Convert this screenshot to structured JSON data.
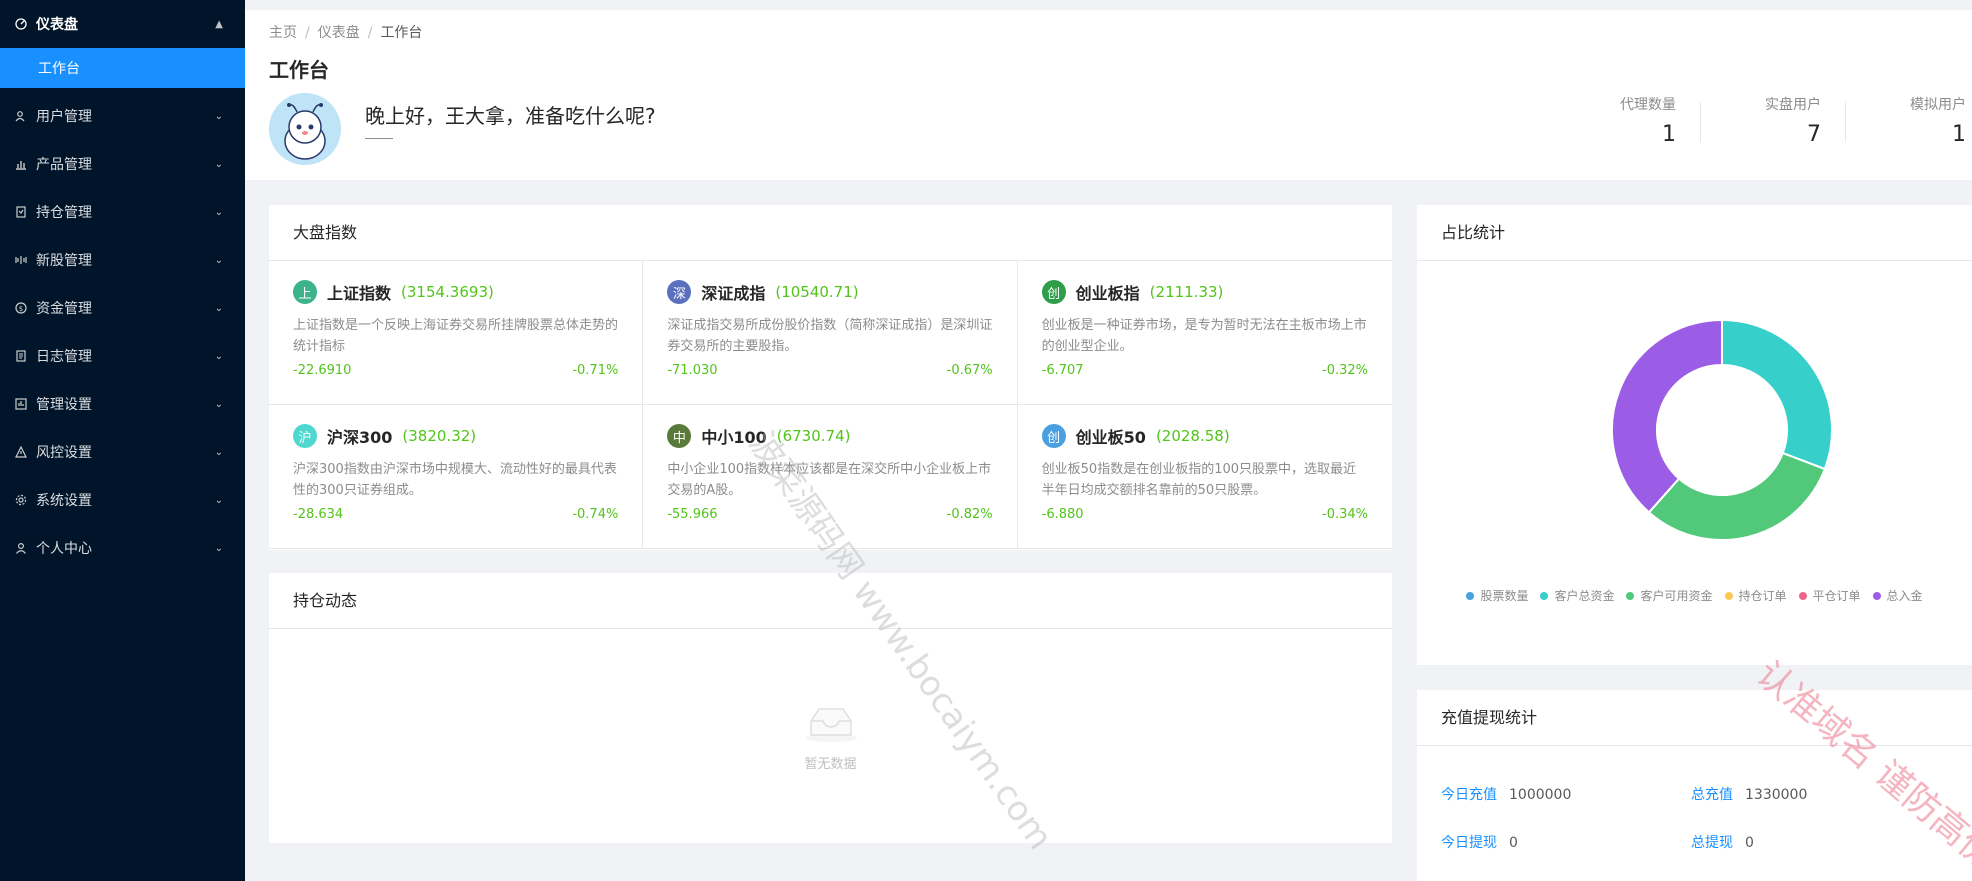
{
  "sidebar": {
    "items": [
      {
        "label": "仪表盘",
        "icon": "dashboard-icon",
        "open": true,
        "children": [
          {
            "label": "工作台"
          }
        ]
      },
      {
        "label": "用户管理",
        "icon": "users-icon"
      },
      {
        "label": "产品管理",
        "icon": "chart-icon"
      },
      {
        "label": "持仓管理",
        "icon": "position-icon"
      },
      {
        "label": "新股管理",
        "icon": "ipo-icon"
      },
      {
        "label": "资金管理",
        "icon": "money-icon"
      },
      {
        "label": "日志管理",
        "icon": "log-icon"
      },
      {
        "label": "管理设置",
        "icon": "admin-icon"
      },
      {
        "label": "风控设置",
        "icon": "warning-icon"
      },
      {
        "label": "系统设置",
        "icon": "gear-icon"
      },
      {
        "label": "个人中心",
        "icon": "user-icon"
      }
    ]
  },
  "breadcrumb": [
    "主页",
    "仪表盘",
    "工作台"
  ],
  "page_title": "工作台",
  "greeting": "晚上好，王大拿，准备吃什么呢?",
  "stats": [
    {
      "label": "代理数量",
      "value": "1"
    },
    {
      "label": "实盘用户",
      "value": "7"
    },
    {
      "label": "模拟用户",
      "value": "1"
    }
  ],
  "market": {
    "title": "大盘指数",
    "indices": [
      {
        "badge": "上",
        "badge_color": "#3db389",
        "name": "上证指数",
        "value": "(3154.3693)",
        "desc": "上证指数是一个反映上海证券交易所挂牌股票总体走势的统计指标",
        "change": "-22.6910",
        "pct": "-0.71%"
      },
      {
        "badge": "深",
        "badge_color": "#5b6fbf",
        "name": "深证成指",
        "value": "(10540.71)",
        "desc": "深证成指交易所成份股价指数（简称深证成指）是深圳证券交易所的主要股指。",
        "change": "-71.030",
        "pct": "-0.67%"
      },
      {
        "badge": "创",
        "badge_color": "#2e9e49",
        "name": "创业板指",
        "value": "(2111.33)",
        "desc": "创业板是一种证券市场，是专为暂时无法在主板市场上市的创业型企业。",
        "change": "-6.707",
        "pct": "-0.32%"
      },
      {
        "badge": "沪",
        "badge_color": "#4fd8d0",
        "name": "沪深300",
        "value": "(3820.32)",
        "desc": "沪深300指数由沪深市场中规模大、流动性好的最具代表性的300只证券组成。",
        "change": "-28.634",
        "pct": "-0.74%"
      },
      {
        "badge": "中",
        "badge_color": "#5a7a3a",
        "name": "中小100",
        "value": "(6730.74)",
        "desc": "中小企业100指数样本应该都是在深交所中小企业板上市交易的A股。",
        "change": "-55.966",
        "pct": "-0.82%"
      },
      {
        "badge": "创",
        "badge_color": "#4a9fe0",
        "name": "创业板50",
        "value": "(2028.58)",
        "desc": "创业板50指数是在创业板指的100只股票中，选取最近半年日均成交额排名靠前的50只股票。",
        "change": "-6.880",
        "pct": "-0.34%"
      }
    ]
  },
  "positions": {
    "title": "持仓动态",
    "empty": "暂无数据"
  },
  "ratio": {
    "title": "占比统计"
  },
  "chart_data": {
    "type": "pie",
    "categories": [
      "股票数量",
      "客户总资金",
      "客户可用资金",
      "持仓订单",
      "平仓订单",
      "总入金"
    ],
    "values": [
      0,
      1,
      1,
      0,
      0,
      1.25
    ],
    "colors": [
      "#4a9fe0",
      "#36cfc9",
      "#52c97a",
      "#fac858",
      "#ee6688",
      "#9b5de5"
    ],
    "legend": "bottom"
  },
  "recharge": {
    "title": "充值提现统计",
    "rows": [
      {
        "label": "今日充值",
        "value": "1000000"
      },
      {
        "label": "总充值",
        "value": "1330000"
      },
      {
        "label": "今日提现",
        "value": "0"
      },
      {
        "label": "总提现",
        "value": "0"
      }
    ]
  },
  "watermarks": [
    "波菜源码网 www.bocaiym.com",
    "认准域名 谨防高仿网站"
  ]
}
